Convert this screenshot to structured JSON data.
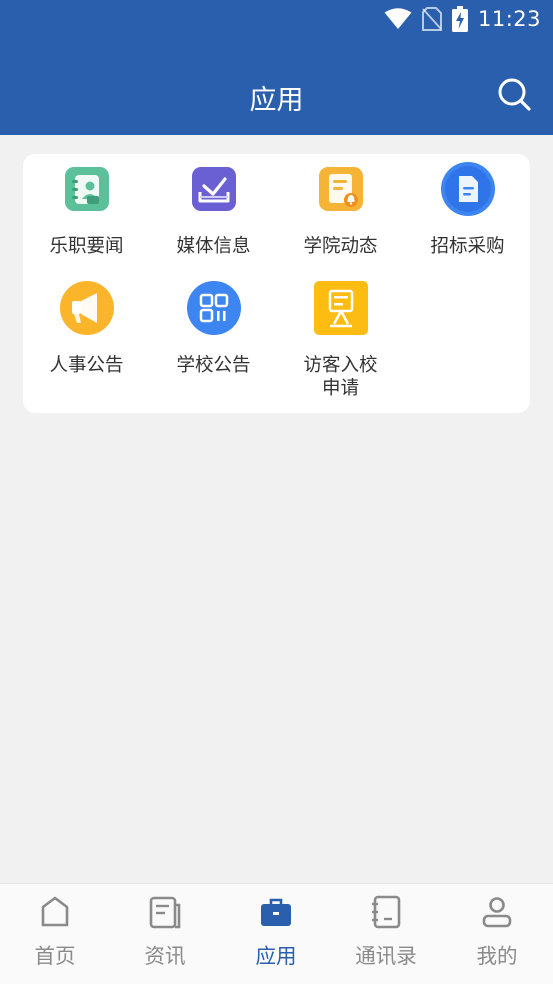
{
  "status": {
    "time": "11:23",
    "icons": [
      "wifi-icon",
      "no-sim-icon",
      "battery-charging-icon"
    ]
  },
  "header": {
    "title": "应用",
    "search_icon": "search-icon"
  },
  "apps": [
    {
      "label": "乐职要闻",
      "icon": "contact-book-icon",
      "color": "#5cc09a"
    },
    {
      "label": "媒体信息",
      "icon": "inbox-check-icon",
      "color": "#6a5fd3"
    },
    {
      "label": "学院动态",
      "icon": "note-bell-icon",
      "color": "#f6b437"
    },
    {
      "label": "招标采购",
      "icon": "document-icon",
      "color": "#3d86f2"
    },
    {
      "label": "人事公告",
      "icon": "megaphone-icon",
      "color": "#fbb52a"
    },
    {
      "label": "学校公告",
      "icon": "qr-code-icon",
      "color": "#3d86f2"
    },
    {
      "label": "访客入校申请",
      "label_lines": [
        "访客入校",
        "申请"
      ],
      "icon": "visitor-board-icon",
      "color": "#fcbc11"
    }
  ],
  "tabs": [
    {
      "label": "首页",
      "icon": "home-icon",
      "active": false
    },
    {
      "label": "资讯",
      "icon": "news-icon",
      "active": false
    },
    {
      "label": "应用",
      "icon": "briefcase-icon",
      "active": true
    },
    {
      "label": "通讯录",
      "icon": "address-book-icon",
      "active": false
    },
    {
      "label": "我的",
      "icon": "user-icon",
      "active": false
    }
  ],
  "colors": {
    "brand": "#2a5fae",
    "background": "#f1f1f1",
    "tab_inactive": "#8a8a8a"
  }
}
